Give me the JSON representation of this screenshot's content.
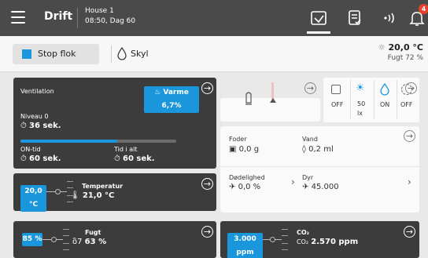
{
  "header": {
    "title": "Drift",
    "house_name": "House 1",
    "house_time": "08:50, Dag 60",
    "notification_count": "4"
  },
  "toolbar": {
    "stop_label": "Stop flok",
    "rinse_label": "Skyl",
    "outdoor_temp": "20,0 °C",
    "outdoor_humidity": "Fugt 72 %"
  },
  "ventilation": {
    "title": "Ventilation",
    "heat_label": "Varme 6,7%",
    "level": "Niveau 0",
    "level_time": "36 sek.",
    "progress": 0.62,
    "on_time_label": "ON-tid",
    "on_time": "60 sek.",
    "total_time_label": "Tid i alt",
    "total_time": "60 sek."
  },
  "temperature": {
    "setpoint": "20,0 °C",
    "label": "Temperatur",
    "value": "21,0 °C"
  },
  "humidity": {
    "setpoint": "85 %",
    "label": "Fugt",
    "value": "63 %"
  },
  "co2": {
    "setpoint": "3.000 ppm",
    "label": "CO₂",
    "value_prefix": "CO₂",
    "value": "2.570 ppm"
  },
  "status": {
    "feed_state": "OFF",
    "light_value": "50",
    "light_unit": "lx",
    "water_state": "ON",
    "timer_state": "OFF"
  },
  "production": {
    "feed_label": "Foder",
    "feed_value": "0,0 g",
    "water_label": "Vand",
    "water_value": "0,2 ml",
    "mortality_label": "Dødelighed",
    "mortality_value": "0,0 %",
    "animals_label": "Dyr",
    "animals_value": "45.000"
  },
  "colors": {
    "accent": "#1a96dc",
    "dark_card": "#3c3c3c",
    "topbar": "#4a4a4a",
    "badge": "#e8412c"
  }
}
